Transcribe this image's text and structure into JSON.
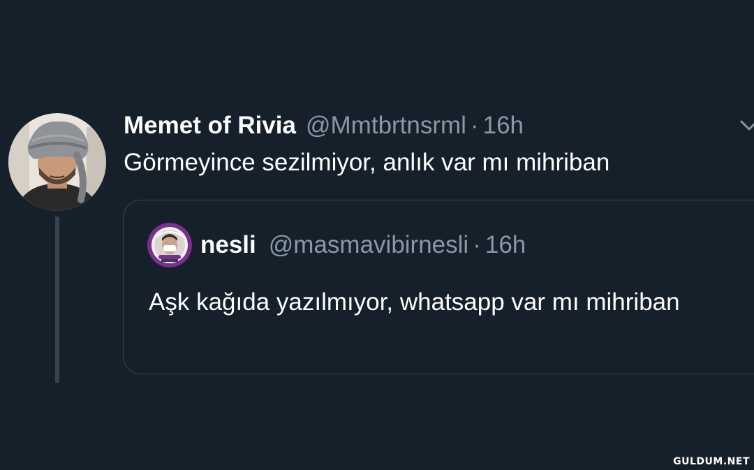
{
  "tweet": {
    "display_name": "Memet of Rivia",
    "handle": "@Mmtbrtnsrml",
    "separator": "·",
    "time": "16h",
    "text": "Görmeyince sezilmiyor, anlık var mı mihriban",
    "menu_icon": "chevron-down-icon",
    "avatar_icon": "profile-avatar"
  },
  "quote": {
    "display_name": "nesli",
    "handle": "@masmavibirnesli",
    "separator": "·",
    "time": "16h",
    "text": "Aşk kağıda yazılmıyor, whatsapp var mı mihriban",
    "avatar_icon": "profile-avatar"
  },
  "watermark": "GULDUM.NET",
  "colors": {
    "background": "#15202b",
    "primary_text": "#ffffff",
    "secondary_text": "#8899a6",
    "border": "#38444d"
  }
}
